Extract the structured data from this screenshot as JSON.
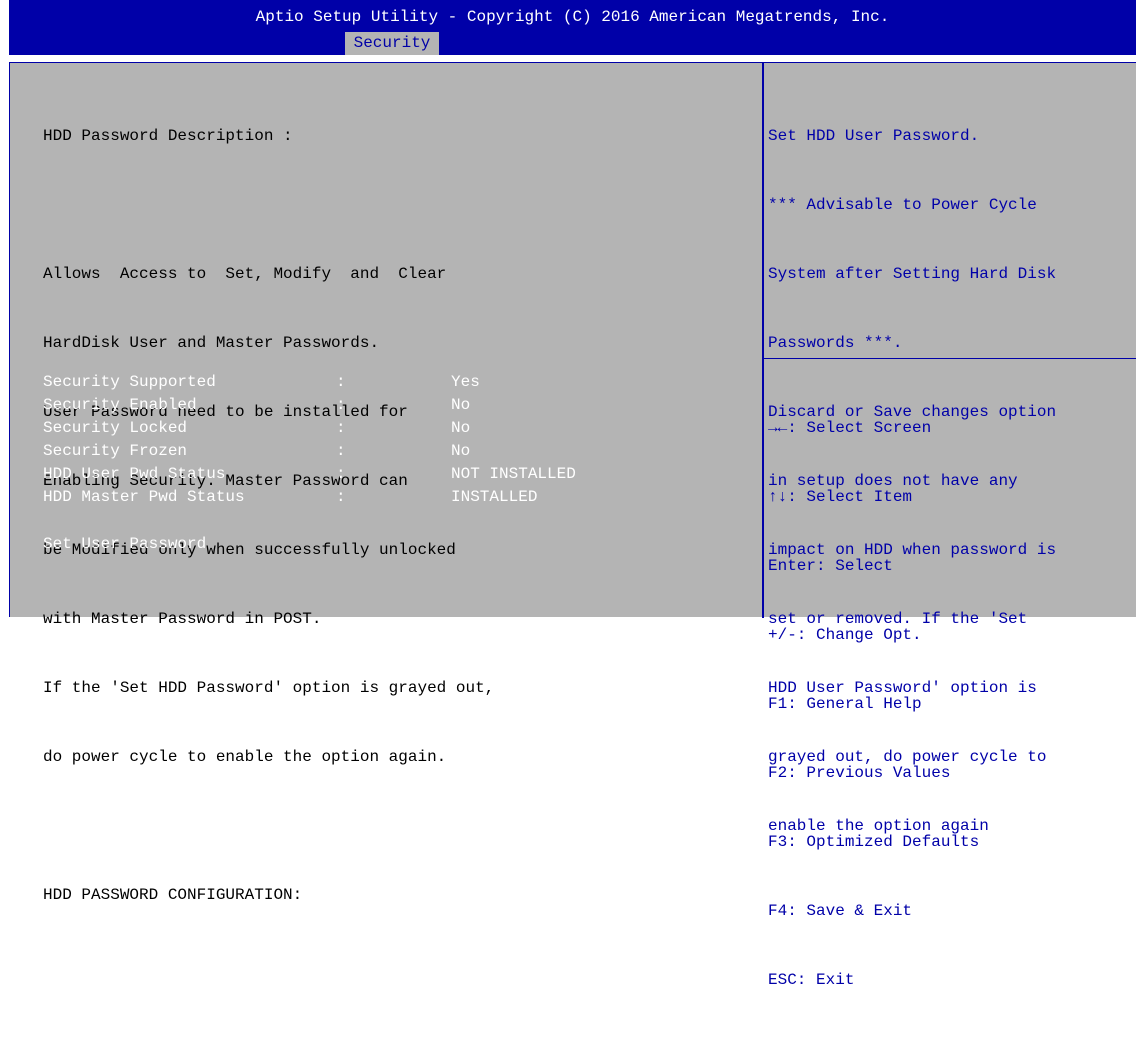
{
  "header": {
    "title": "Aptio Setup Utility - Copyright (C) 2016 American Megatrends, Inc.",
    "active_tab": "Security"
  },
  "description": {
    "heading": "HDD Password Description :",
    "lines": [
      "Allows  Access to  Set, Modify  and  Clear",
      "HardDisk User and Master Passwords.",
      "User Password need to be installed for",
      "Enabling Security. Master Password can",
      "be Modified only when successfully unlocked",
      "with Master Password in POST.",
      "If the 'Set HDD Password' option is grayed out,",
      "do power cycle to enable the option again."
    ]
  },
  "config": {
    "heading": "HDD PASSWORD CONFIGURATION:",
    "rows": [
      {
        "label": "Security Supported",
        "sep": ":",
        "value": "Yes"
      },
      {
        "label": "Security Enabled",
        "sep": ":",
        "value": "No"
      },
      {
        "label": "Security Locked",
        "sep": ":",
        "value": "No"
      },
      {
        "label": "Security Frozen",
        "sep": ":",
        "value": "No"
      },
      {
        "label": "HDD User Pwd Status",
        "sep": ":",
        "value": "NOT INSTALLED"
      },
      {
        "label": "HDD Master Pwd Status",
        "sep": ":",
        "value": "INSTALLED"
      }
    ],
    "set_user_password": "Set User Password"
  },
  "help": {
    "lines": [
      "Set HDD User Password.",
      "*** Advisable to Power Cycle",
      "System after Setting Hard Disk",
      "Passwords ***.",
      "Discard or Save changes option",
      "in setup does not have any",
      "impact on HDD when password is",
      "set or removed. If the 'Set",
      "HDD User Password' option is",
      "grayed out, do power cycle to",
      "enable the option again"
    ]
  },
  "keys": [
    "→←: Select Screen",
    "↑↓: Select Item",
    "Enter: Select",
    "+/-: Change Opt.",
    "F1: General Help",
    "F2: Previous Values",
    "F3: Optimized Defaults",
    "F4: Save & Exit",
    "ESC: Exit"
  ],
  "colors": {
    "accent_blue": "#0000a8",
    "panel_gray": "#b4b4b4",
    "text_white": "#ffffff"
  }
}
